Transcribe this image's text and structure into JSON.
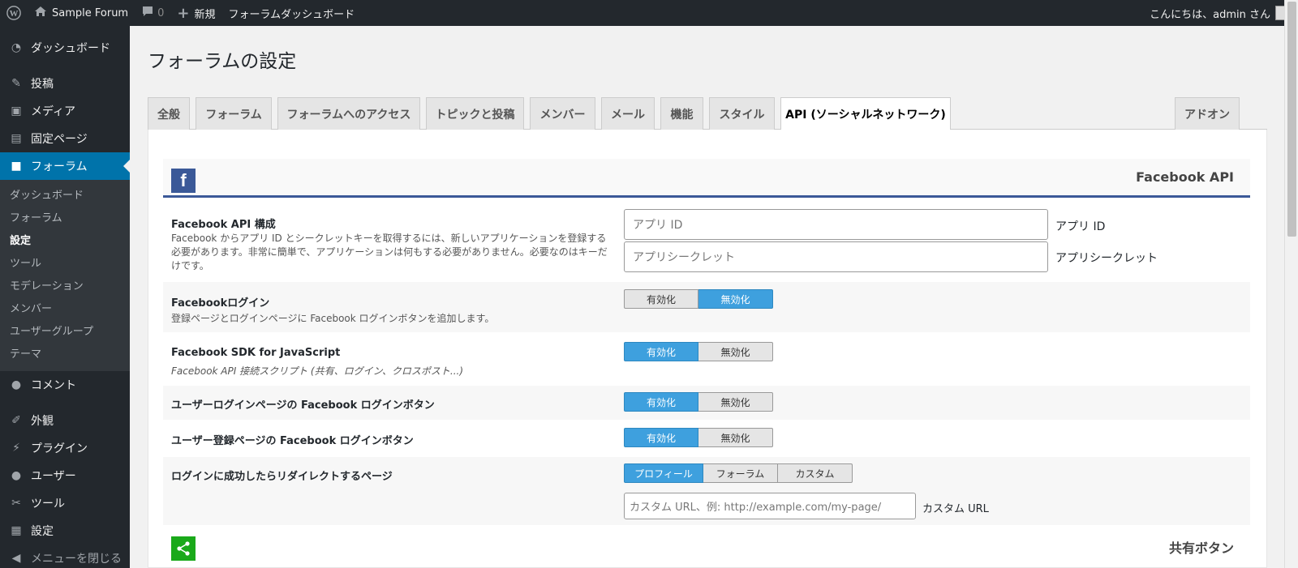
{
  "adminbar": {
    "site_name": "Sample Forum",
    "comments_count": "0",
    "new_label": "新規",
    "dashboard_link": "フォーラムダッシュボード",
    "greeting": "こんにちは、admin さん"
  },
  "sidebar": {
    "items": [
      {
        "label": "ダッシュボード",
        "icon": "dashboard-icon"
      },
      {
        "label": "投稿",
        "icon": "pin-icon"
      },
      {
        "label": "メディア",
        "icon": "media-icon"
      },
      {
        "label": "固定ページ",
        "icon": "page-icon"
      },
      {
        "label": "フォーラム",
        "icon": "forum-icon"
      },
      {
        "label": "コメント",
        "icon": "comment-icon"
      },
      {
        "label": "外観",
        "icon": "appearance-icon"
      },
      {
        "label": "プラグイン",
        "icon": "plugin-icon"
      },
      {
        "label": "ユーザー",
        "icon": "user-icon"
      },
      {
        "label": "ツール",
        "icon": "wrench-icon"
      },
      {
        "label": "設定",
        "icon": "settings-icon"
      },
      {
        "label": "メニューを閉じる",
        "icon": "collapse-icon"
      }
    ],
    "submenu": [
      "ダッシュボード",
      "フォーラム",
      "設定",
      "ツール",
      "モデレーション",
      "メンバー",
      "ユーザーグループ",
      "テーマ"
    ]
  },
  "page": {
    "title": "フォーラムの設定",
    "tabs": [
      "全般",
      "フォーラム",
      "フォーラムへのアクセス",
      "トピックと投稿",
      "メンバー",
      "メール",
      "機能",
      "スタイル",
      "API (ソーシャルネットワーク)",
      "アドオン"
    ],
    "active_tab": "API (ソーシャルネットワーク)"
  },
  "facebook": {
    "section_title": "Facebook API",
    "config": {
      "label": "Facebook API 構成",
      "desc": "Facebook からアプリ ID とシークレットキーを取得するには、新しいアプリケーションを登録する必要があります。非常に簡単で、アプリケーションは何もする必要がありません。必要なのはキーだけです。",
      "app_id_placeholder": "アプリ ID",
      "app_id_label": "アプリ ID",
      "app_secret_placeholder": "アプリシークレット",
      "app_secret_label": "アプリシークレット"
    },
    "login": {
      "label": "Facebookログイン",
      "desc": "登録ページとログインページに Facebook ログインボタンを追加します。",
      "enable": "有効化",
      "disable": "無効化",
      "state": "disable"
    },
    "sdk": {
      "label": "Facebook SDK for JavaScript",
      "desc": "Facebook API 接続スクリプト (共有、ログイン、クロスポスト...)",
      "enable": "有効化",
      "disable": "無効化",
      "state": "enable"
    },
    "login_page_button": {
      "label": "ユーザーログインページの Facebook ログインボタン",
      "enable": "有効化",
      "disable": "無効化",
      "state": "enable"
    },
    "register_page_button": {
      "label": "ユーザー登録ページの Facebook ログインボタン",
      "enable": "有効化",
      "disable": "無効化",
      "state": "enable"
    },
    "redirect": {
      "label": "ログインに成功したらリダイレクトするページ",
      "options": [
        "プロフィール",
        "フォーラム",
        "カスタム"
      ],
      "selected": "プロフィール",
      "custom_url_placeholder": "カスタム URL、例: http://example.com/my-page/",
      "custom_url_label": "カスタム URL"
    }
  },
  "share": {
    "section_title": "共有ボタン"
  },
  "colors": {
    "adminbar": "#23282d",
    "accent": "#0073aa",
    "toggle_on": "#3ea0de",
    "facebook": "#3b5998",
    "share": "#1aa91a"
  }
}
